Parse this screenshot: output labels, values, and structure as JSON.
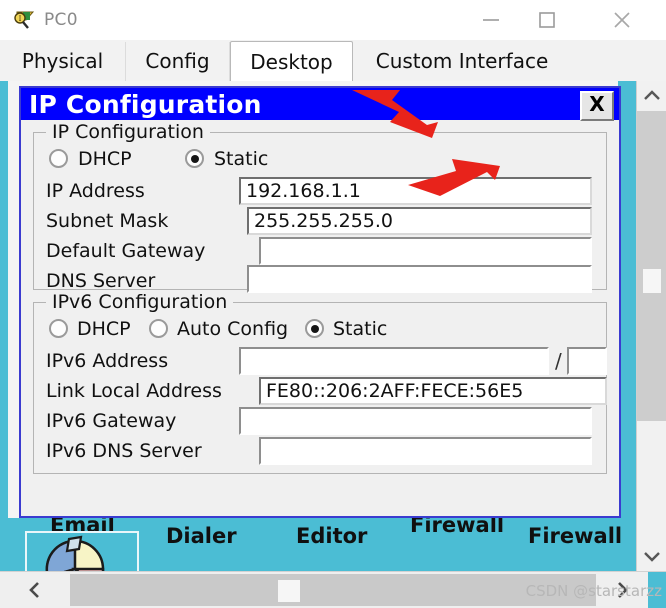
{
  "window": {
    "title": "PC0",
    "icon": "packet-tracer-device-icon",
    "clipped_top_text": "",
    "controls": {
      "minimize": "—",
      "maximize": "□",
      "close": "✕"
    }
  },
  "tabs": [
    {
      "label": "Physical",
      "active": false
    },
    {
      "label": "Config",
      "active": false
    },
    {
      "label": "Desktop",
      "active": true
    },
    {
      "label": "Custom Interface",
      "active": false
    }
  ],
  "dialog": {
    "title": "IP Configuration",
    "close_label": "X",
    "ipv4": {
      "legend": "IP Configuration",
      "modes": [
        {
          "label": "DHCP",
          "selected": false
        },
        {
          "label": "Static",
          "selected": true
        }
      ],
      "fields": [
        {
          "label": "IP Address",
          "value": "192.168.1.1"
        },
        {
          "label": "Subnet Mask",
          "value": "255.255.255.0"
        },
        {
          "label": "Default Gateway",
          "value": ""
        },
        {
          "label": "DNS Server",
          "value": ""
        }
      ]
    },
    "ipv6": {
      "legend": "IPv6 Configuration",
      "modes": [
        {
          "label": "DHCP",
          "selected": false
        },
        {
          "label": "Auto Config",
          "selected": false
        },
        {
          "label": "Static",
          "selected": true
        }
      ],
      "address_label": "IPv6 Address",
      "address_value": "",
      "prefix_separator": "/",
      "prefix_value": "",
      "fields": [
        {
          "label": "Link Local Address",
          "value": "FE80::206:2AFF:FECE:56E5"
        },
        {
          "label": "IPv6 Gateway",
          "value": ""
        },
        {
          "label": "IPv6 DNS Server",
          "value": ""
        }
      ]
    }
  },
  "desktop_background": {
    "labels": [
      "Email",
      "Dialer",
      "Editor",
      "Firewall",
      "Firewall"
    ]
  },
  "scrollbars": {
    "vertical": {
      "up": "⌃",
      "down": "⌄"
    },
    "horizontal": {
      "left": "‹",
      "right": "›"
    }
  },
  "watermark": "CSDN @starstarzz",
  "bottom_ghost_text": "",
  "colors": {
    "dialog_title_bg": "#0000FF",
    "desktop_cyan": "#4BBDD4",
    "annotation_red": "#E8231B",
    "active_tab_bg": "#FFFFFF"
  }
}
